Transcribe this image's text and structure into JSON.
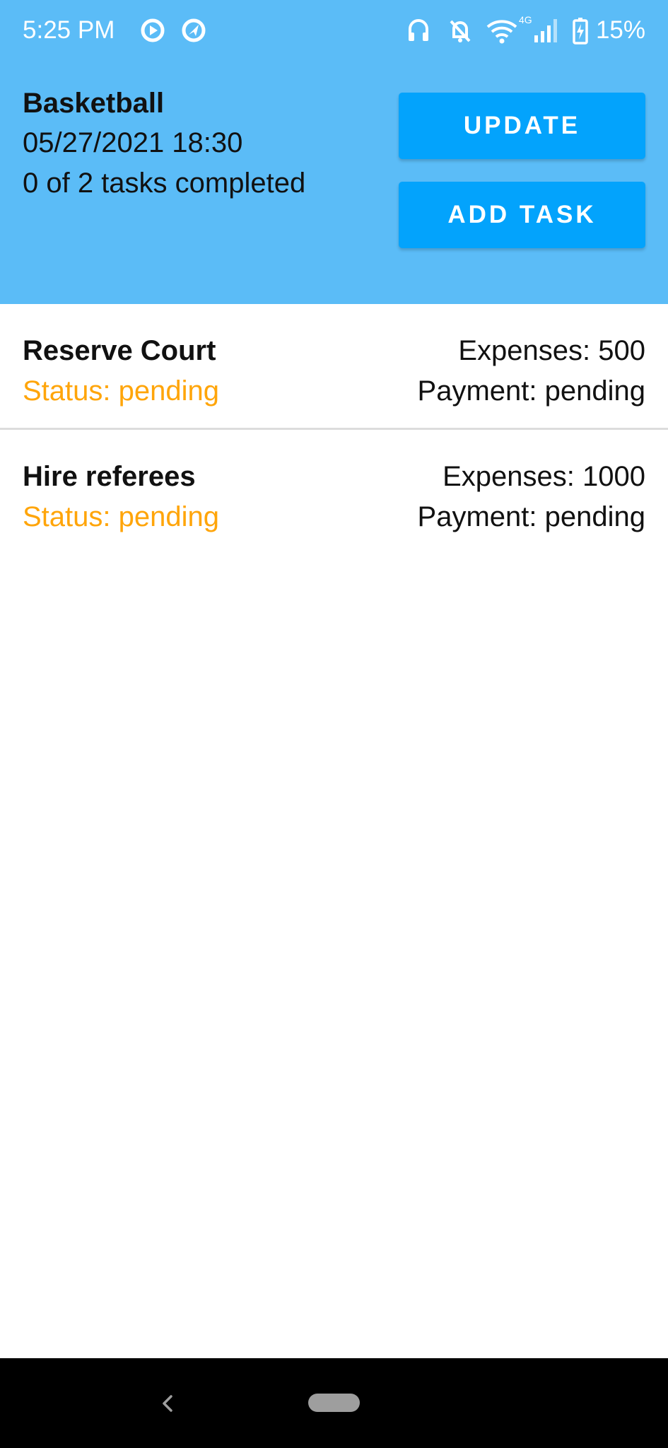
{
  "status_bar": {
    "time": "5:25 PM",
    "battery": "15%",
    "network": "4G",
    "icons": [
      "play-circle-icon",
      "location-sync-icon",
      "headset-icon",
      "bell-off-icon",
      "wifi-icon",
      "cell-signal-icon",
      "battery-charging-icon"
    ]
  },
  "event": {
    "title": "Basketball",
    "datetime": "05/27/2021 18:30",
    "progress": "0 of 2 tasks completed"
  },
  "buttons": {
    "update": "UPDATE",
    "add_task": "ADD TASK"
  },
  "tasks": [
    {
      "name": "Reserve Court",
      "status": "Status: pending",
      "expenses": "Expenses: 500",
      "payment": "Payment: pending"
    },
    {
      "name": "Hire referees",
      "status": "Status: pending",
      "expenses": "Expenses: 1000",
      "payment": "Payment: pending"
    }
  ],
  "colors": {
    "header_bg": "#5bbcf7",
    "button_bg": "#03a3fc",
    "status_pending": "#ffa50a"
  },
  "nav": {
    "icons": [
      "back-icon",
      "home-pill-icon"
    ]
  }
}
